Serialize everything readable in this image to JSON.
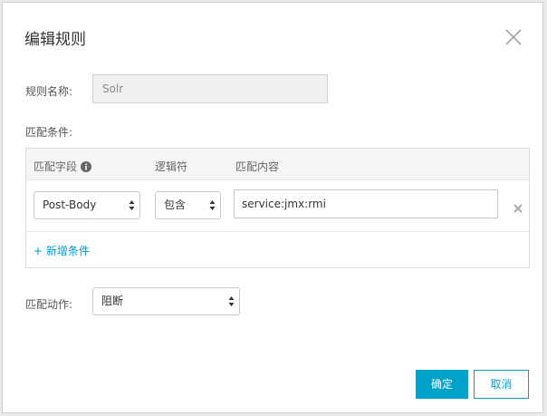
{
  "dialog": {
    "title": "编辑规则",
    "name_label": "规则名称:",
    "name_value": "Solr",
    "conditions_label": "匹配条件:",
    "columns": {
      "field": "匹配字段",
      "operator": "逻辑符",
      "content": "匹配内容"
    },
    "condition": {
      "field": "Post-Body",
      "operator": "包含",
      "content": "service:jmx:rmi"
    },
    "add_condition": "+ 新增条件",
    "action_label": "匹配动作:",
    "action_value": "阻断",
    "ok": "确定",
    "cancel": "取消"
  },
  "icons": [
    "close-icon",
    "info-icon",
    "select-arrows-icon",
    "delete-icon"
  ],
  "colors": {
    "accent": "#00a2ca",
    "link": "#0099cc"
  }
}
